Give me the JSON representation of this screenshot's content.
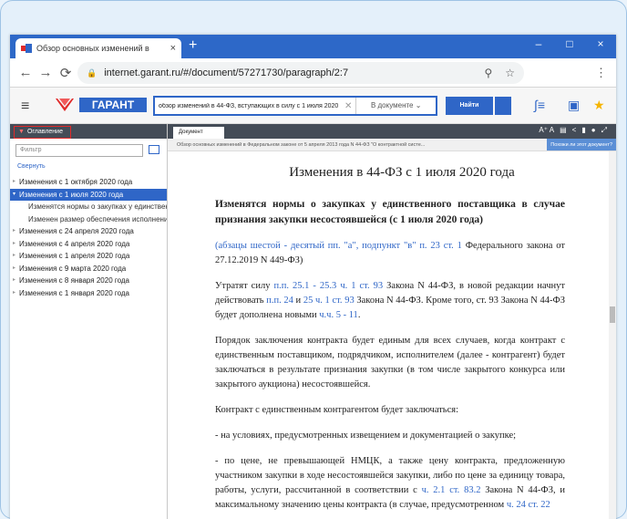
{
  "browser": {
    "tab_title": "Обзор основных изменений в",
    "tab_close": "×",
    "new_tab": "+",
    "url": "internet.garant.ru/#/document/57271730/paragraph/2:7",
    "win_minimize": "–",
    "win_maximize": "□",
    "win_close": "×"
  },
  "garant": {
    "logo_text": "ГАРАНТ",
    "search_query": "обзор изменений в 44-ФЗ, вступающих в силу с 1 июля 2020",
    "search_scope": "В документе",
    "find_button": "Найти"
  },
  "left_panel": {
    "header": "Оглавление",
    "filter_placeholder": "Фильтр",
    "collapse_link": "Свернуть",
    "items": [
      {
        "label": "Изменения с 1 октября 2020 года"
      },
      {
        "label": "Изменения с 1 июля 2020 года"
      },
      {
        "label": "Изменятся нормы о закупках у единственного"
      },
      {
        "label": "Изменен размер обеспечения исполнения"
      },
      {
        "label": "Изменения с 24 апреля 2020 года"
      },
      {
        "label": "Изменения с 4 апреля 2020 года"
      },
      {
        "label": "Изменения с 1 апреля 2020 года"
      },
      {
        "label": "Изменения с 9 марта 2020 года"
      },
      {
        "label": "Изменения с 8 января 2020 года"
      },
      {
        "label": "Изменения с 1 января 2020 года"
      }
    ]
  },
  "right_panel": {
    "doc_tab": "Документ",
    "breadcrumb": "Обзор основных изменений в Федеральном законе от 5 апреля 2013 года N 44-ФЗ \"О контрактной систе...",
    "breadcrumb_link": "Похожи ли этот документ?",
    "doc_title": "Изменения в 44-ФЗ с 1 июля 2020 года",
    "heading": "Изменятся нормы о закупках у единственного поставщика в случае признания закупки несостоявшейся (с 1 июля 2020 года)",
    "p1_link": "(абзацы шестой - десятый пп. \"а\", подпункт \"в\" п. 23 ст. 1",
    "p1_text": " Федерального закона от 27.12.2019 N 449-ФЗ)",
    "p2_a": "Утратят силу ",
    "p2_l1": "п.п. 25.1 - 25.3 ч. 1 ст. 93",
    "p2_b": " Закона N 44-ФЗ, в новой редакции начнут действовать ",
    "p2_l2": "п.п. 24",
    "p2_c": " и ",
    "p2_l3": "25 ч. 1 ст. 93",
    "p2_d": " Закона N 44-ФЗ. Кроме того, ст. 93 Закона N 44-ФЗ будет дополнена новыми ",
    "p2_l4": "ч.ч. 5 - 11",
    "p2_e": ".",
    "p3": "Порядок заключения контракта будет единым для всех случаев, когда контракт с единственным поставщиком, подрядчиком, исполнителем (далее - контрагент) будет заключаться в результате признания закупки (в том числе закрытого конкурса или закрытого аукциона) несостоявшейся.",
    "p4": "Контракт с единственным контрагентом будет заключаться:",
    "p5": "- на условиях, предусмотренных извещением и документацией о закупке;",
    "p6_a": "- по цене, не превышающей НМЦК, а также цену контракта, предложенную участником закупки в ходе несостоявшейся закупки, либо по цене за единицу товара, работы, услуги, рассчитанной в соответствии с ",
    "p6_l1": "ч. 2.1 ст. 83.2",
    "p6_b": " Закона N 44-ФЗ, и максимальному значению цены контракта (в случае, предусмотренном ",
    "p6_l2": "ч. 24 ст. 22"
  },
  "colors": {
    "accent": "#2f66c7",
    "dark_bar": "#444c57",
    "highlight_border": "#e02a2a"
  }
}
